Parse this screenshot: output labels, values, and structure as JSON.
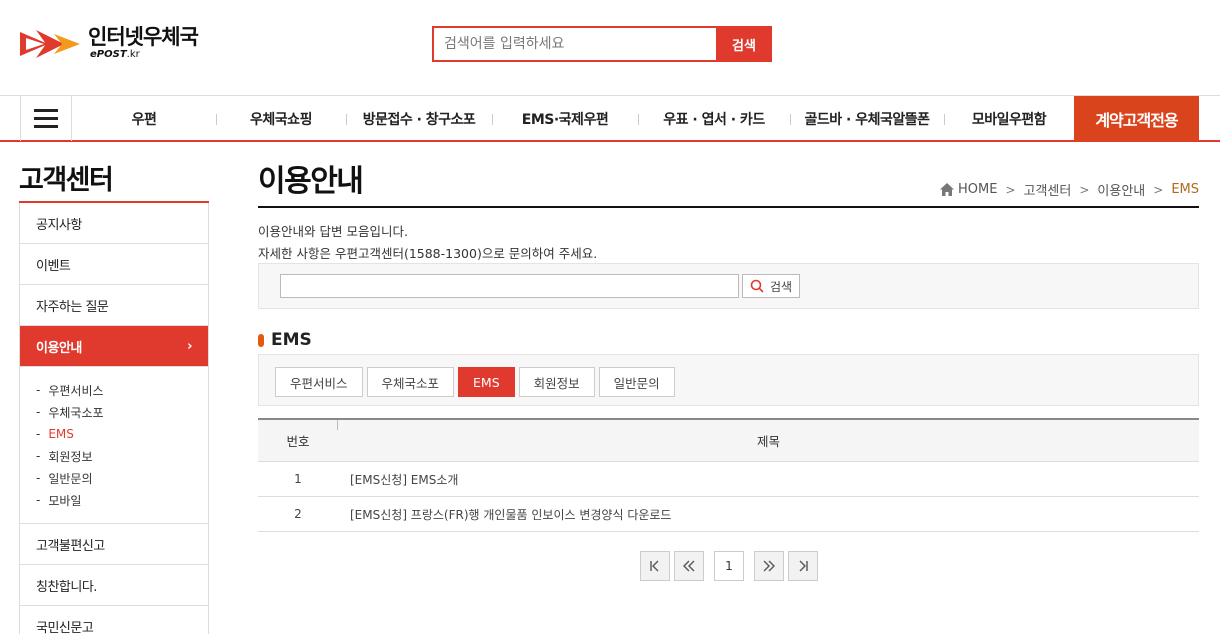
{
  "header": {
    "logo_main": "인터넷우체국",
    "logo_sub": "ePOST",
    "logo_sub_kr": ".kr",
    "search_placeholder": "검색어를 입력하세요",
    "search_button": "검색"
  },
  "nav": {
    "items": [
      "우편",
      "우체국쇼핑",
      "방문접수 · 창구소포",
      "EMS·국제우편",
      "우표 · 엽서 · 카드",
      "골드바 · 우체국알뜰폰",
      "모바일우편함"
    ],
    "contract": "계약고객전용"
  },
  "sidebar": {
    "title": "고객센터",
    "items_top": [
      "공지사항",
      "이벤트",
      "자주하는 질문"
    ],
    "active": "이용안내",
    "active_arrow": "›",
    "sub_items": [
      "우편서비스",
      "우체국소포",
      "EMS",
      "회원정보",
      "일반문의",
      "모바일"
    ],
    "sub_dash": "-",
    "items_bottom": [
      "고객불편신고",
      "칭찬합니다.",
      "국민신문고"
    ]
  },
  "main": {
    "title": "이용안내",
    "breadcrumb": [
      "HOME",
      "고객센터",
      "이용안내",
      "EMS"
    ],
    "breadcrumb_sep": ">",
    "desc1": "이용안내와 답변 모음입니다.",
    "desc2": "자세한 사항은 우편고객센터(1588-1300)으로 문의하여 주세요.",
    "search_button": "검색",
    "section_title": "EMS",
    "tabs": [
      "우편서비스",
      "우체국소포",
      "EMS",
      "회원정보",
      "일반문의"
    ],
    "table": {
      "headers": [
        "번호",
        "제목"
      ],
      "rows": [
        {
          "no": "1",
          "title": "[EMS신청] EMS소개"
        },
        {
          "no": "2",
          "title": "[EMS신청] 프랑스(FR)행 개인물품 인보이스 변경양식 다운로드"
        }
      ]
    },
    "pager": {
      "current": "1"
    }
  },
  "colors": {
    "accent": "#e03a2e",
    "contract": "#d9441d",
    "breadcrumb_current": "#b06a1c"
  }
}
